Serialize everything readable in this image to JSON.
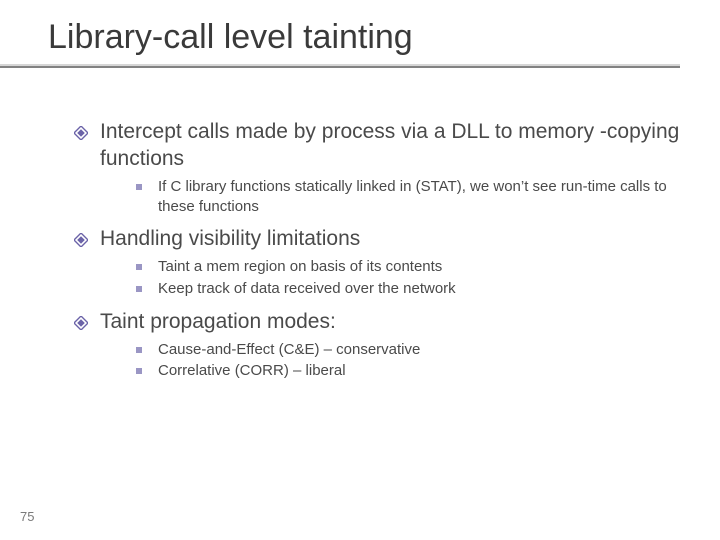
{
  "title": "Library-call level tainting",
  "bullets": {
    "b1": "Intercept calls made by process via a DLL to memory -copying functions",
    "b1_1": "If C library functions statically linked in (STAT), we won’t see run-time calls to these functions",
    "b2": "Handling visibility limitations",
    "b2_1": "Taint a mem region on basis of its contents",
    "b2_2": "Keep track of data received over the network",
    "b3": "Taint propagation modes:",
    "b3_1": "Cause-and-Effect (C&E) – conservative",
    "b3_2": "Correlative (CORR) – liberal"
  },
  "page_number": "75"
}
